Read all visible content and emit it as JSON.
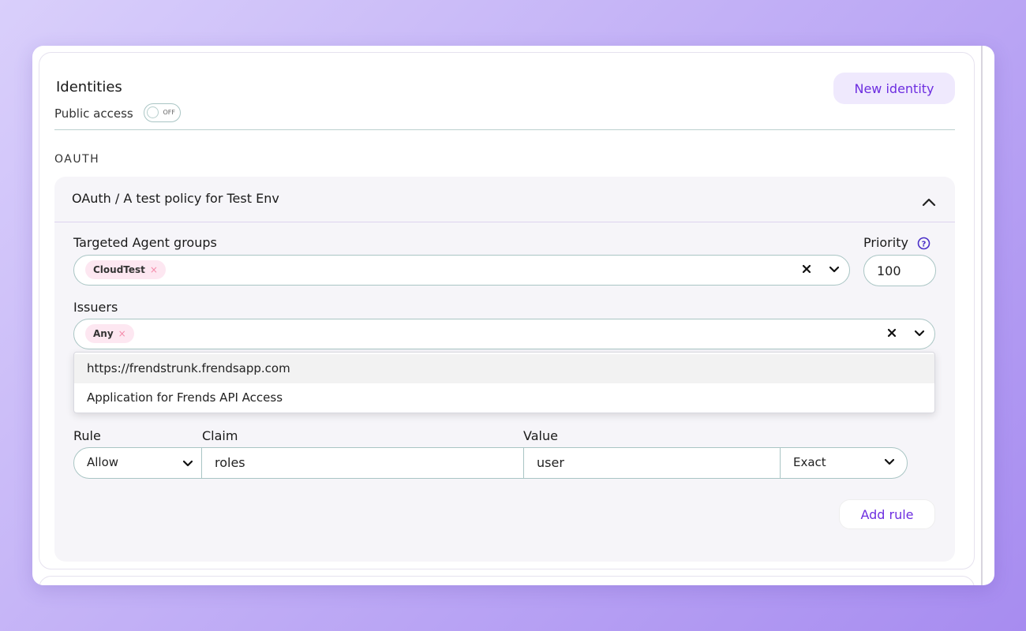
{
  "page": {
    "title": "Identities",
    "public_access_label": "Public access",
    "public_access_state": "OFF",
    "new_identity_label": "New identity",
    "section_label": "OAUTH"
  },
  "policy": {
    "header": "OAuth / A test policy for Test Env",
    "targeted_label": "Targeted Agent groups",
    "targeted_tags": [
      "CloudTest"
    ],
    "priority_label": "Priority",
    "priority_value": "100",
    "issuers_label": "Issuers",
    "issuer_tags": [
      "Any"
    ],
    "issuer_options": [
      "https://frendstrunk.frendsapp.com",
      "Application for Frends API Access"
    ],
    "rule_headers": {
      "rule": "Rule",
      "claim": "Claim",
      "value": "Value"
    },
    "rule": {
      "action": "Allow",
      "claim": "roles",
      "value": "user",
      "match": "Exact"
    },
    "add_rule_label": "Add rule"
  },
  "colors": {
    "accent": "#6d2ee0",
    "tag_bg": "#fde7f1",
    "border": "#a9c5c4"
  }
}
